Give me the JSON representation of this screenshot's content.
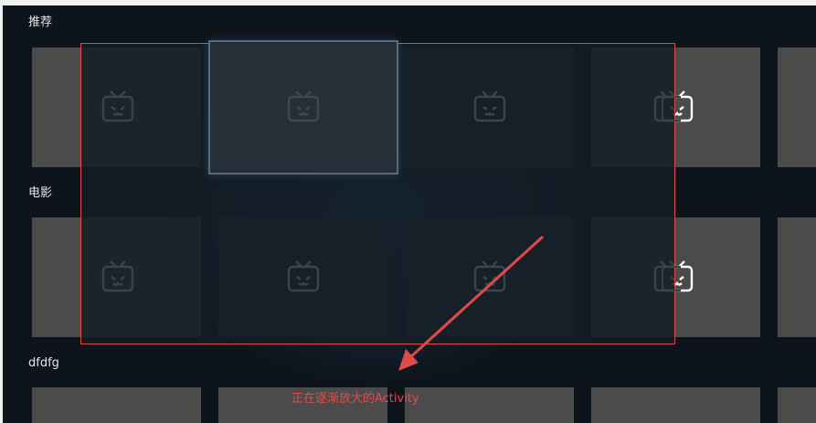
{
  "rows": [
    {
      "title": "推荐"
    },
    {
      "title": "电影"
    },
    {
      "title": "dfdfg"
    }
  ],
  "annotation": {
    "text": "正在逐渐放大的Activity",
    "color": "#e24a4a"
  },
  "icons": {
    "placeholder": "tv-placeholder-icon"
  },
  "colors": {
    "background": "#0d141b",
    "card": "#4b4b4b",
    "highlight_border": "#e24a4a"
  }
}
